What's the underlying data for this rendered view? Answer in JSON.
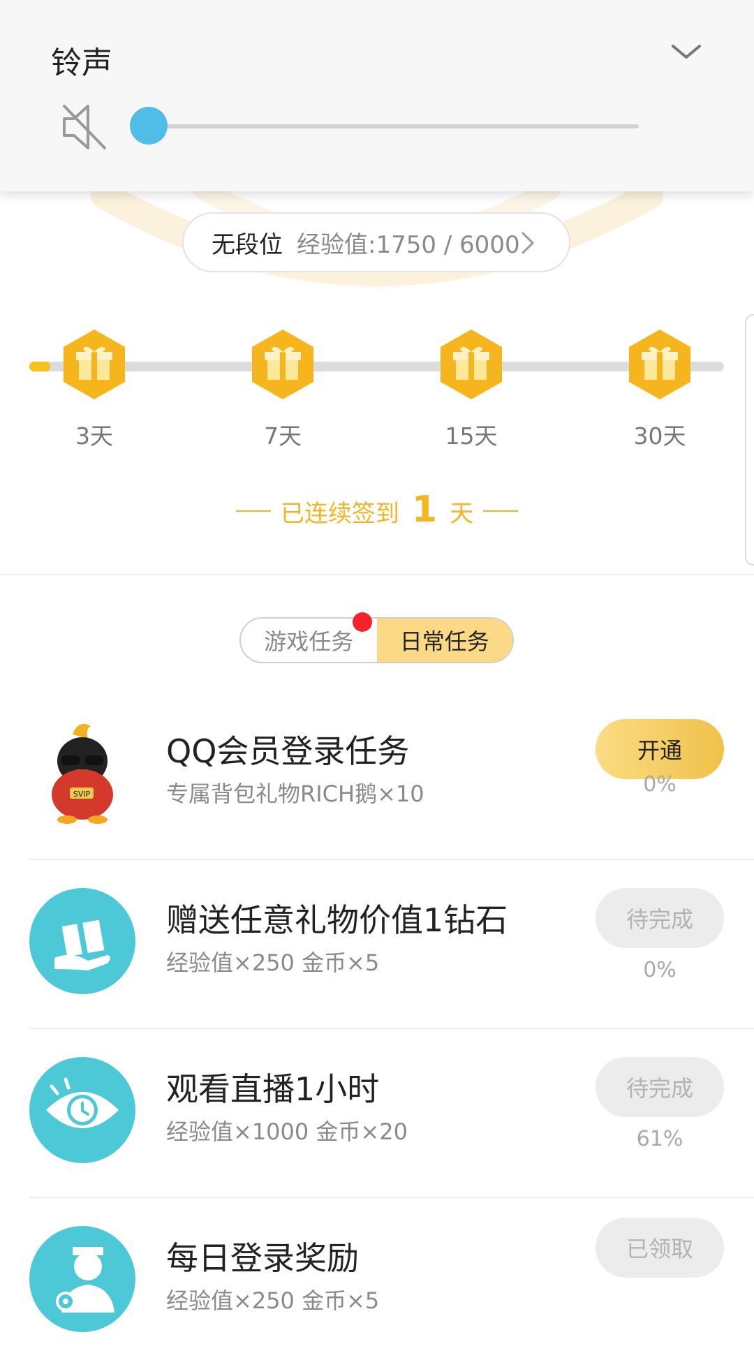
{
  "volume_panel": {
    "title": "铃声",
    "level": 0.0
  },
  "rank": {
    "name": "无段位",
    "exp_text": "经验值:1750 / 6000"
  },
  "signin": {
    "progress": 0.03,
    "milestones": [
      {
        "label": "3天"
      },
      {
        "label": "7天"
      },
      {
        "label": "15天"
      },
      {
        "label": "30天"
      }
    ],
    "streak_prefix": "已连续签到",
    "streak_days": "1",
    "streak_suffix": "天"
  },
  "tabs": [
    {
      "label": "游戏任务",
      "active": false,
      "has_dot": true
    },
    {
      "label": "日常任务",
      "active": true
    }
  ],
  "tasks": [
    {
      "title": "QQ会员登录任务",
      "subtitle": "专属背包礼物RICH鹅×10",
      "button": "开通",
      "progress": "0%",
      "icon": "svip-penguin-icon"
    },
    {
      "title": "赠送任意礼物价值1钻石",
      "subtitle": "经验值×250 金币×5",
      "button": "待完成",
      "progress": "0%",
      "icon": "gift-hand-icon"
    },
    {
      "title": "观看直播1小时",
      "subtitle": "经验值×1000 金币×20",
      "button": "待完成",
      "progress": "61%",
      "icon": "eye-clock-icon"
    },
    {
      "title": "每日登录奖励",
      "subtitle": "经验值×250 金币×5",
      "button": "已领取",
      "progress": "",
      "icon": "user-login-icon"
    }
  ],
  "colors": {
    "accent_gold": "#f3b623",
    "teal": "#4dc8d6",
    "volume_blue": "#4fbde6",
    "dot_red": "#f2232b"
  }
}
